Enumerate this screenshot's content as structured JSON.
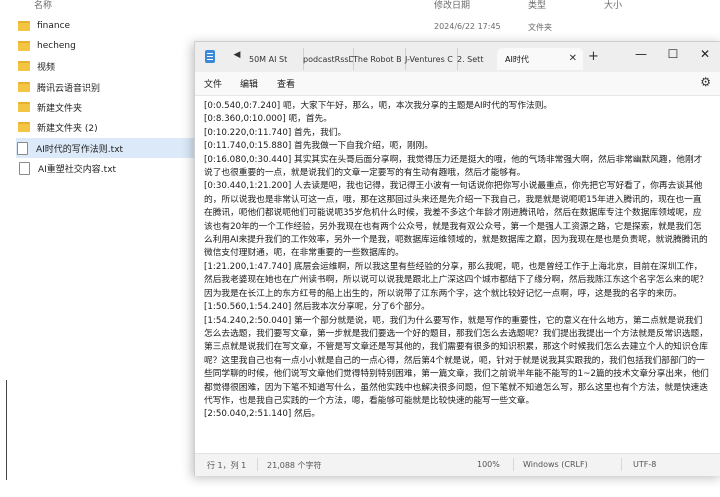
{
  "explorer": {
    "header": {
      "name": "名称",
      "date": "修改日期",
      "type": "类型",
      "size": "大小"
    },
    "items": [
      {
        "name": "finance",
        "kind": "folder",
        "date": "2024/6/22 17:45",
        "type": "文件夹"
      },
      {
        "name": "hecheng",
        "kind": "folder"
      },
      {
        "name": "视频",
        "kind": "folder"
      },
      {
        "name": "腾讯云语音识别",
        "kind": "folder"
      },
      {
        "name": "新建文件夹",
        "kind": "folder"
      },
      {
        "name": "新建文件夹 (2)",
        "kind": "folder"
      },
      {
        "name": "AI时代的写作法则.txt",
        "kind": "txt"
      },
      {
        "name": "AI重塑社交内容.txt",
        "kind": "txt"
      }
    ]
  },
  "notepad": {
    "tabs": [
      {
        "label": "50M AI St"
      },
      {
        "label": "podcastRssD"
      },
      {
        "label": "The Robot B"
      },
      {
        "label": "J-Ventures C"
      },
      {
        "label": "2. Sett"
      },
      {
        "label": "AI时代"
      }
    ],
    "menu": {
      "file": "文件",
      "edit": "编辑",
      "view": "查看"
    },
    "lines": [
      "[0:0.540,0:7.240]  呃，大家下午好，那么，呃，本次我分享的主题是AI时代的写作法则。",
      "[0:8.360,0:10.000]  呃，首先。",
      "[0:10.220,0:11.740]  首先，我们。",
      "[0:11.740,0:15.880]  首先我做一下自我介绍，呃，刚刚。",
      "[0:16.080,0:30.440]  其实其实在头哥后面分享啊，我觉得压力还是挺大的哦，他的气场非常强大啊，然后非常幽默风趣，他刚才说了也很重要的一点，就是说我们的文章一定要写的有生动有趣哦，然后才能够有。",
      "[0:30.440,1:21.200]  人去读是吧，我也记得，我记得王小波有一句话说你把你写小说最重点，你先把它写好看了，你再去谈其他的，所以说我也是非常认可这一点，哦，那在这那回过头来还是先介绍一下我自己，我是就是说呃呃15年进入腾讯的，现在也一直在腾讯，呃他们都说呃他们可能说呃35岁危机什么时候，我差不多这个年龄才刚进腾讯哈，然后在数据库专注个数据库领域呢，应该也有20年的一个工作经验，另外我现在也有两个公众号，就是我有双公众号，第一个是强人工资源之路，它是探索，就是我们怎么利用AI来提升我们的工作效率，另外一个是我，呃数据库运维领域的，就是数据库之巅，因为我现在是也是负责呢，就说腾腾讯的微信支付理财通，呃，在非常重要的一些数据库的。",
      "[1:21.200,1:47.740]  底层会运维啊，所以我这里有些经验的分享，那么我呢，呃，也是曾经工作于上海北京，目前在深圳工作，然后我老婆现在她也在广州读书啊，所以说可以说我是跟北上广深这四个城市都结下了缘分啊，然后我陈江东这个名字怎么来的呢？因为我是在长江上的东方红号的船上出生的，所以说带了江东两个字，这个就比较好记忆一点啊，呼，这是我的名字的来历。",
      "[1:50.560,1:54.240]  然后我本次分享呢，分了6个部分。",
      "[1:54.240,2:50.040]  第一个部分就是说，呃，我们为什么要写作，就是写作的重要性，它的意义在什么地方，第二点就是说我们怎么去选题，我们要写文章，第一步就是我们要选一个好的题目，那我们怎么去选题呢？我们提出我提出一个方法就是反常识选题，第三点就是说我们在写文章，不管是写文章还是写其他的，我们需要有很多的知识积累，那这个时候我们怎么去建立个人的知识仓库呢？这里我自己也有一点小小就是自己的一点心得，然后第4个就是说，呃，针对于就是说我其实跟我的，我们包括我们部部门的一些同学聊的时候，他们说写文章他们觉得特别特别困难，第一篇文章，我们之前说半年能不能写的1~2篇的技术文章分享出来，他们都觉得很困难，因为下笔不知道写什么，虽然他实践中也解决很多问题，但下笔就不知道怎么写，那么这里也有个方法，就是快速迭代写作，也是我自己实践的一个方法，嗯，看能够可能就是比较快速的能写一些文章。",
      "[2:50.040,2:51.140]  然后。"
    ],
    "status": {
      "position": "行 1，列 1",
      "chars": "21,088 个字符",
      "zoom": "100%",
      "eol": "Windows (CRLF)",
      "encoding": "UTF-8"
    }
  }
}
